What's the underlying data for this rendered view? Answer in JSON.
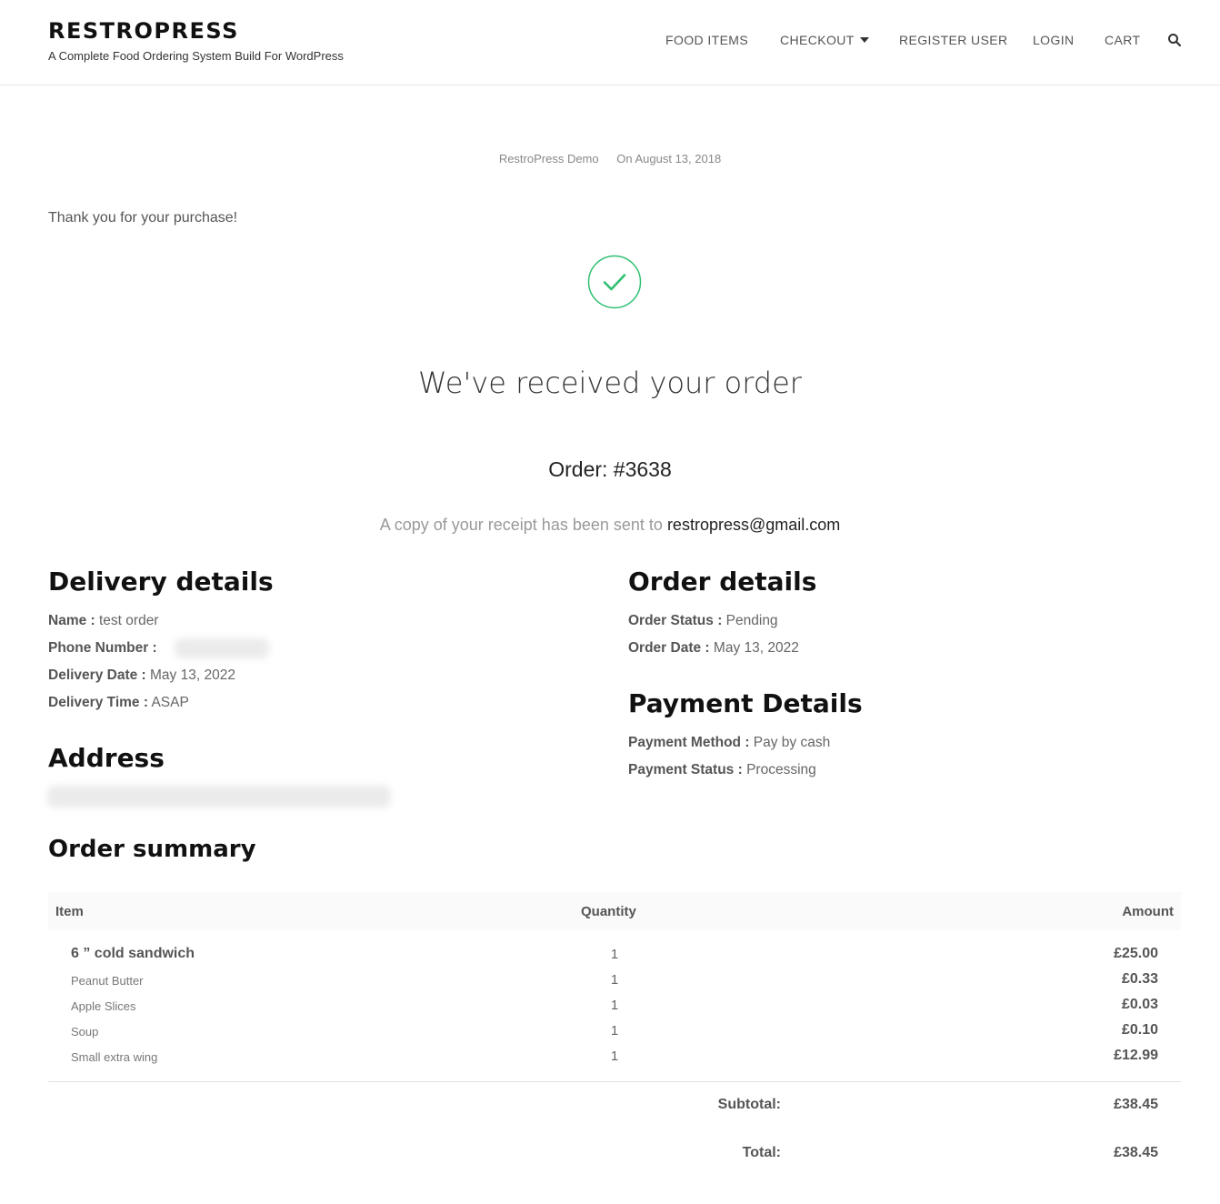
{
  "header": {
    "title": "RESTROPRESS",
    "tagline": "A Complete Food Ordering System Build For WordPress",
    "nav": [
      {
        "label": "FOOD ITEMS"
      },
      {
        "label": "CHECKOUT"
      },
      {
        "label": "REGISTER USER"
      },
      {
        "label": "LOGIN"
      },
      {
        "label": "CART"
      }
    ],
    "search_icon": "search-icon"
  },
  "meta": {
    "author": "RestroPress Demo",
    "date": "On August 13, 2018"
  },
  "thanks": "Thank you for your purchase!",
  "confirmation": {
    "icon": "check-circle-icon",
    "accent": "#2fbf71",
    "heading": "We've received your order",
    "order_number": "Order: #3638",
    "receipt_prefix": "A copy of your receipt has been sent to",
    "email": "restropress@gmail.com"
  },
  "delivery": {
    "heading": "Delivery details",
    "name_label": "Name :",
    "name_value": "test order",
    "phone_label": "Phone Number :",
    "date_label": "Delivery Date :",
    "date_value": "May 13, 2022",
    "time_label": "Delivery Time :",
    "time_value": "ASAP"
  },
  "address": {
    "heading": "Address"
  },
  "order_details": {
    "heading": "Order details",
    "status_label": "Order Status :",
    "status_value": "Pending",
    "date_label": "Order Date :",
    "date_value": "May 13, 2022"
  },
  "payment": {
    "heading": "Payment Details",
    "method_label": "Payment Method :",
    "method_value": "Pay by cash",
    "status_label": "Payment Status :",
    "status_value": "Processing"
  },
  "summary": {
    "heading": "Order summary",
    "columns": [
      "Item",
      "Quantity",
      "Amount"
    ],
    "items": [
      {
        "name": "6 ” cold sandwich",
        "qty": "1",
        "amount": "£25.00"
      },
      {
        "name": "Peanut Butter",
        "qty": "1",
        "amount": "£0.33"
      },
      {
        "name": "Apple Slices",
        "qty": "1",
        "amount": "£0.03"
      },
      {
        "name": "Soup",
        "qty": "1",
        "amount": "£0.10"
      },
      {
        "name": "Small extra wing",
        "qty": "1",
        "amount": "£12.99"
      }
    ],
    "subtotal_label": "Subtotal:",
    "subtotal_value": "£38.45",
    "total_label": "Total:",
    "total_value": "£38.45"
  }
}
